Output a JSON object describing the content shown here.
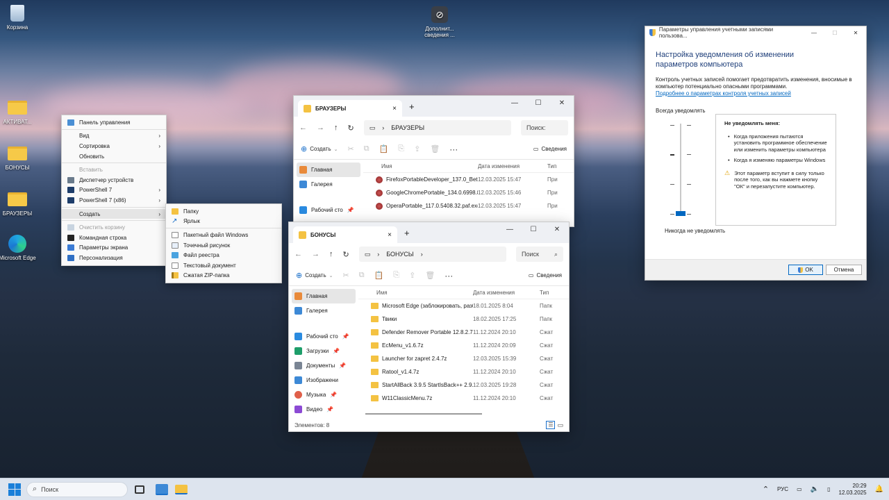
{
  "desktop": {
    "icons": [
      {
        "name": "recycle-bin",
        "label": "Корзина"
      },
      {
        "name": "ms-info",
        "label": "Дополнит... сведения ..."
      },
      {
        "name": "activation",
        "label": "АКТИВАТ..."
      },
      {
        "name": "bonuses",
        "label": "БОНУСЫ"
      },
      {
        "name": "browsers",
        "label": "БРАУЗЕРЫ"
      },
      {
        "name": "edge",
        "label": "Microsoft Edge"
      }
    ]
  },
  "context_menu": {
    "items": [
      {
        "label": "Панель управления",
        "kind": "item"
      },
      {
        "label": "Вид",
        "kind": "submenu"
      },
      {
        "label": "Сортировка",
        "kind": "submenu"
      },
      {
        "label": "Обновить",
        "kind": "item"
      },
      {
        "label": "Вставить",
        "kind": "disabled"
      },
      {
        "label": "Диспетчер устройств",
        "kind": "item"
      },
      {
        "label": "PowerShell 7",
        "kind": "submenu"
      },
      {
        "label": "PowerShell 7 (x86)",
        "kind": "submenu"
      },
      {
        "label": "Создать",
        "kind": "submenu-open"
      },
      {
        "label": "Очистить корзину",
        "kind": "disabled"
      },
      {
        "label": "Командная строка",
        "kind": "item"
      },
      {
        "label": "Параметры экрана",
        "kind": "item"
      },
      {
        "label": "Персонализация",
        "kind": "item"
      }
    ]
  },
  "create_menu": {
    "items": [
      "Папку",
      "Ярлык",
      "Пакетный файл Windows",
      "Точечный рисунок",
      "Файл реестра",
      "Текстовый документ",
      "Сжатая ZIP-папка"
    ]
  },
  "explorer_browsers": {
    "tab": "БРАУЗЕРЫ",
    "path": "БРАУЗЕРЫ",
    "search": "Поиск:",
    "create": "Создать",
    "details": "Сведения",
    "nav": [
      "Главная",
      "Галерея",
      "Рабочий сто"
    ],
    "columns": {
      "name": "Имя",
      "date": "Дата изменения",
      "type": "Тип"
    },
    "files": [
      {
        "name": "FirefoxPortableDeveloper_137.0_Beta_2_E...",
        "date": "12.03.2025 15:47",
        "type": "При"
      },
      {
        "name": "GoogleChromePortable_134.0.6998.89_o...",
        "date": "12.03.2025 15:46",
        "type": "При"
      },
      {
        "name": "OperaPortable_117.0.5408.32.paf.exe",
        "date": "12.03.2025 15:47",
        "type": "При"
      }
    ]
  },
  "explorer_bonus": {
    "tab": "БОНУСЫ",
    "path": "БОНУСЫ",
    "search": "Поиск",
    "create": "Создать",
    "details": "Сведения",
    "nav": [
      "Главная",
      "Галерея",
      "Рабочий сто",
      "Загрузки",
      "Документы",
      "Изображени",
      "Музыка",
      "Видео"
    ],
    "columns": {
      "name": "Имя",
      "date": "Дата изменения",
      "type": "Тип"
    },
    "files": [
      {
        "name": "Microsoft Edge (заблокировать, разбло...",
        "date": "18.01.2025 8:04",
        "type": "Папк"
      },
      {
        "name": "Твики",
        "date": "18.02.2025 17:25",
        "type": "Папк"
      },
      {
        "name": "Defender Remover Portable 12.8.2.7z",
        "date": "11.12.2024 20:10",
        "type": "Сжат"
      },
      {
        "name": "EcMenu_v1.6.7z",
        "date": "11.12.2024 20:09",
        "type": "Сжат"
      },
      {
        "name": "Launcher for zapret 2.4.7z",
        "date": "12.03.2025 15:39",
        "type": "Сжат"
      },
      {
        "name": "Ratool_v1.4.7z",
        "date": "11.12.2024 20:10",
        "type": "Сжат"
      },
      {
        "name": "StartAllBack 3.9.5 StartIsBack++ 2.9.20 (2....",
        "date": "12.03.2025 19:28",
        "type": "Сжат"
      },
      {
        "name": "W11ClassicMenu.7z",
        "date": "11.12.2024 20:10",
        "type": "Сжат"
      }
    ],
    "status": "Элементов: 8"
  },
  "uac": {
    "title": "Параметры управления учетными записями пользова...",
    "heading": "Настройка уведомления об изменении параметров компьютера",
    "desc": "Контроль учетных записей помогает предотвратить изменения, вносимые в компьютер потенциально опасными программами.",
    "link": "Подробнее о параметрах контроля учетных записей",
    "top": "Всегда уведомлять",
    "bottom": "Никогда не уведомлять",
    "box_title": "Не уведомлять меня:",
    "bullet1": "Когда приложения пытаются установить программное обеспечение или изменить параметры компьютера",
    "bullet2": "Когда я изменяю параметры Windows",
    "warning": "Этот параметр вступит в силу только после того, как вы нажмете кнопку \"ОК\" и перезапустите компьютер.",
    "slider_level": "0 of 3",
    "ok": "OK",
    "cancel": "Отмена"
  },
  "taskbar": {
    "search": "Поиск",
    "lang": "РУС",
    "time": "20:29",
    "date": "12.03.2025"
  },
  "colors": {
    "accent": "#0067c0",
    "folder": "#f6c948"
  }
}
